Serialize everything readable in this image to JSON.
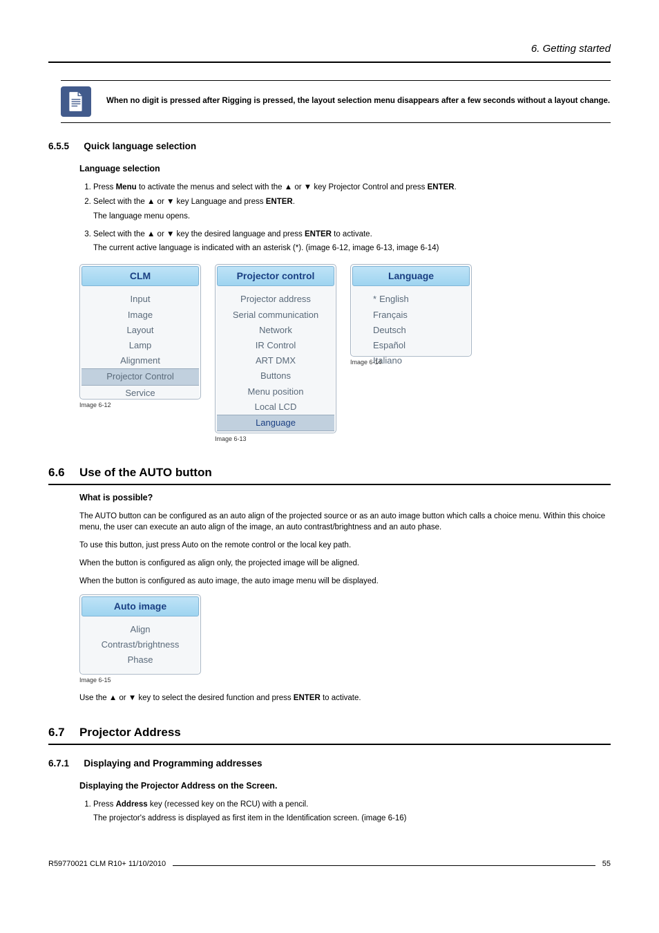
{
  "header": {
    "chapter": "6.  Getting started"
  },
  "note": {
    "text": "When no digit is pressed after Rigging is pressed, the layout selection menu disappears after a few seconds without a layout change."
  },
  "s655": {
    "num": "6.5.5",
    "title": "Quick language selection",
    "sub": "Language selection",
    "step1_a": "Press ",
    "step1_b": "Menu",
    "step1_c": " to activate the menus and select with the ▲ or ▼ key Projector Control and press ",
    "step1_d": "ENTER",
    "step1_e": ".",
    "step2_a": "Select with the ▲ or ▼ key Language and press ",
    "step2_b": "ENTER",
    "step2_c": ".",
    "step2_note": "The language menu opens.",
    "step3_a": "Select with the ▲ or ▼ key the desired language and press ",
    "step3_b": "ENTER",
    "step3_c": " to activate.",
    "step3_note": "The current active language is indicated with an asterisk (*). (image 6-12, image 6-13, image 6-14)"
  },
  "menus": {
    "m612": {
      "title": "CLM",
      "items": [
        "Input",
        "Image",
        "Layout",
        "Lamp",
        "Alignment",
        "Projector Control",
        "Service"
      ],
      "selected_index": 5,
      "caption": "Image 6-12"
    },
    "m613": {
      "title": "Projector control",
      "items": [
        "Projector address",
        "Serial communication",
        "Network",
        "IR Control",
        "ART DMX",
        "Buttons",
        "Menu position",
        "Local LCD",
        "Language"
      ],
      "selected_index": 8,
      "caption": "Image 6-13"
    },
    "m614": {
      "title": "Language",
      "items": [
        "English",
        "Français",
        "Deutsch",
        "Español",
        "Italiano"
      ],
      "active_index": 0,
      "caption": "Image 6-14"
    }
  },
  "s66": {
    "num": "6.6",
    "title": "Use of the AUTO button",
    "sub": "What is possible?",
    "p1": "The AUTO button can be configured as an auto align of the projected source or as an auto image button which calls a choice menu. Within this choice menu, the user can execute an auto align of the image, an auto contrast/brightness and an auto phase.",
    "p2": "To use this button, just press Auto on the remote control or the local key path.",
    "p3": "When the button is configured as align only, the projected image will be aligned.",
    "p4": "When the button is configured as auto image, the auto image menu will be displayed.",
    "m615": {
      "title": "Auto image",
      "items": [
        "Align",
        "Contrast/brightness",
        "Phase"
      ],
      "caption": "Image 6-15"
    },
    "p5_a": "Use the ▲ or ▼ key to select the desired function and press ",
    "p5_b": "ENTER",
    "p5_c": " to activate."
  },
  "s67": {
    "num": "6.7",
    "title": "Projector Address"
  },
  "s671": {
    "num": "6.7.1",
    "title": "Displaying and Programming addresses",
    "sub": "Displaying the Projector Address on the Screen.",
    "step1_a": "Press ",
    "step1_b": "Address",
    "step1_c": " key (recessed key on the RCU) with a pencil.",
    "step1_note": "The projector's address is displayed as first item in the Identification screen. (image 6-16)"
  },
  "footer": {
    "left": "R59770021  CLM R10+  11/10/2010",
    "right": "55"
  }
}
